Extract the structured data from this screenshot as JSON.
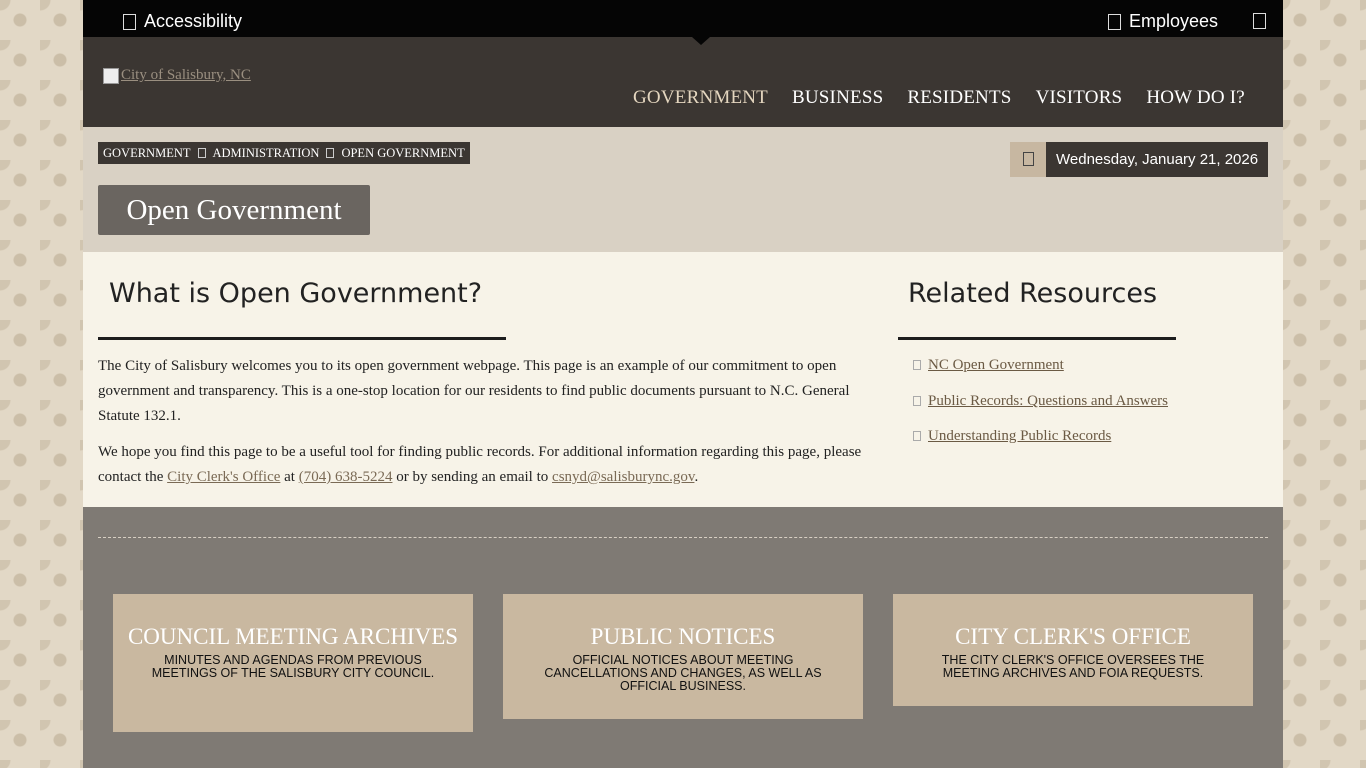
{
  "utility": {
    "accessibility": "Accessibility",
    "employees": "Employees"
  },
  "header": {
    "logo_alt": "City of Salisbury, NC",
    "nav": [
      "GOVERNMENT",
      "BUSINESS",
      "RESIDENTS",
      "VISITORS",
      "HOW DO I?"
    ]
  },
  "breadcrumb": [
    "GOVERNMENT",
    "ADMINISTRATION",
    "OPEN GOVERNMENT"
  ],
  "date": "Wednesday, January 21, 2026",
  "page_title": "Open Government",
  "main": {
    "heading": "What is Open Government?",
    "p1": "The City of Salisbury welcomes you to its open government webpage. This page is an example of our commitment to open government and transparency. This is a one-stop location for our residents to find public documents pursuant to N.C. General Statute 132.1.",
    "p2_start": "We hope you find this page to be a useful tool for finding public records. For additional information regarding this page, please contact the ",
    "p2_link1": "City Clerk's Office",
    "p2_at": " at ",
    "p2_link2": "(704) 638-5224",
    "p2_mid": " or by sending an email to ",
    "p2_link3": "csnyd@salisburync.gov",
    "p2_end": "."
  },
  "related": {
    "heading": "Related Resources",
    "items": [
      "NC Open Government",
      "Public Records: Questions and Answers",
      "Understanding Public Records"
    ]
  },
  "cards": [
    {
      "title": "COUNCIL MEETING ARCHIVES",
      "desc": "MINUTES AND AGENDAS FROM PREVIOUS MEETINGS OF THE SALISBURY CITY COUNCIL."
    },
    {
      "title": "PUBLIC NOTICES",
      "desc": "OFFICIAL NOTICES ABOUT MEETING CANCELLATIONS AND CHANGES, AS WELL AS OFFICIAL BUSINESS."
    },
    {
      "title": "CITY CLERK'S OFFICE",
      "desc": "THE CITY CLERK'S OFFICE OVERSEES THE MEETING ARCHIVES AND FOIA REQUESTS."
    }
  ]
}
